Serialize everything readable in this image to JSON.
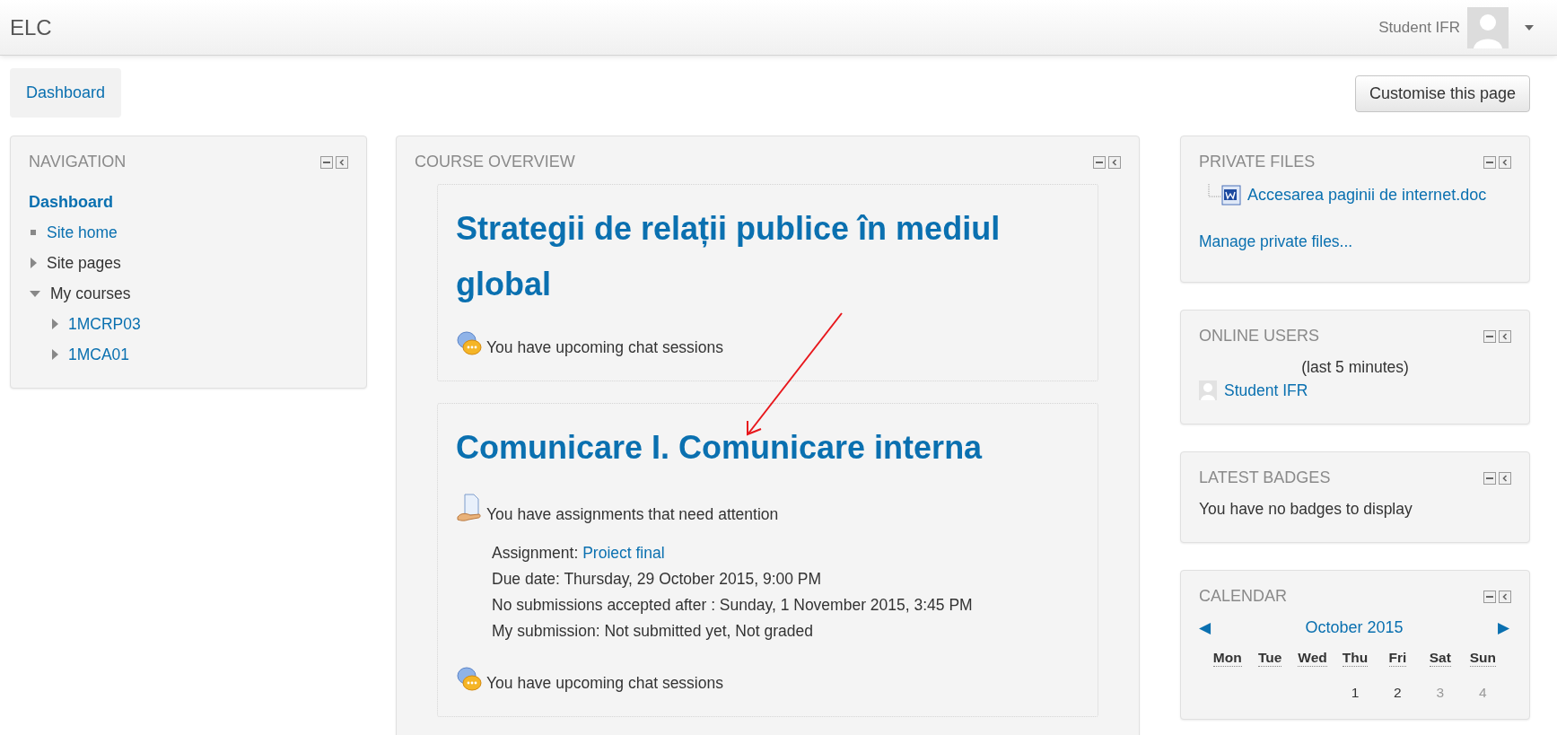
{
  "header": {
    "site_name": "ELC",
    "user_name": "Student IFR"
  },
  "breadcrumb": [
    "Dashboard"
  ],
  "customise_button": "Customise this page",
  "navigation": {
    "title": "NAVIGATION",
    "home": "Dashboard",
    "items": [
      {
        "label": "Site home",
        "kind": "leaf",
        "link": true
      },
      {
        "label": "Site pages",
        "kind": "branch",
        "link": false,
        "expanded": false
      },
      {
        "label": "My courses",
        "kind": "branch",
        "link": false,
        "expanded": true,
        "children": [
          {
            "label": "1MCRP03",
            "kind": "branch",
            "link": true,
            "expanded": false
          },
          {
            "label": "1MCA01",
            "kind": "branch",
            "link": true,
            "expanded": false
          }
        ]
      }
    ]
  },
  "course_overview": {
    "title": "COURSE OVERVIEW",
    "courses": [
      {
        "title": "Strategii de relații publice în mediul global",
        "notices": [
          {
            "kind": "chat",
            "text": "You have upcoming chat sessions"
          }
        ]
      },
      {
        "title": "Comunicare I. Comunicare interna",
        "notices": [
          {
            "kind": "assignment",
            "text": "You have assignments that need attention",
            "details": [
              {
                "text": "Assignment:",
                "link": "Proiect final"
              },
              {
                "text": "Due date: Thursday, 29 October 2015, 9:00 PM"
              },
              {
                "text": "No submissions accepted after : Sunday, 1 November 2015, 3:45 PM"
              },
              {
                "text": "My submission: Not submitted yet, Not graded"
              }
            ]
          },
          {
            "kind": "chat",
            "text": "You have upcoming chat sessions"
          }
        ]
      }
    ]
  },
  "private_files": {
    "title": "PRIVATE FILES",
    "files": [
      "Accesarea paginii de internet.doc"
    ],
    "manage_link": "Manage private files..."
  },
  "online_users": {
    "title": "ONLINE USERS",
    "period": "(last 5 minutes)",
    "users": [
      "Student IFR"
    ]
  },
  "latest_badges": {
    "title": "LATEST BADGES",
    "message": "You have no badges to display"
  },
  "calendar": {
    "title": "CALENDAR",
    "prev": "◀",
    "month": "October 2015",
    "next": "▶",
    "weekdays": [
      "Mon",
      "Tue",
      "Wed",
      "Thu",
      "Fri",
      "Sat",
      "Sun"
    ],
    "days": [
      {
        "label": "1",
        "weekend": false
      },
      {
        "label": "2",
        "weekend": false
      },
      {
        "label": "3",
        "weekend": true
      },
      {
        "label": "4",
        "weekend": true
      }
    ]
  }
}
